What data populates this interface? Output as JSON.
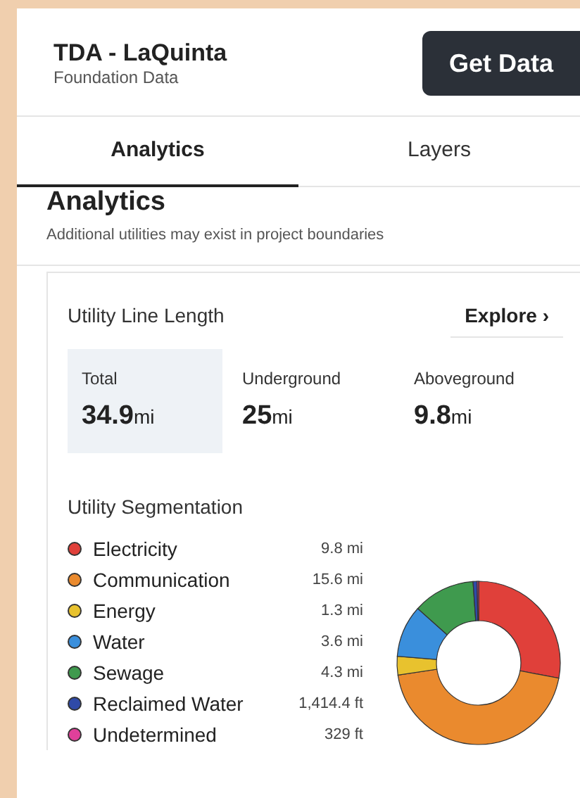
{
  "header": {
    "title": "TDA - LaQuinta",
    "subtitle": "Foundation Data",
    "button": "Get Data"
  },
  "tabs": [
    {
      "label": "Analytics",
      "selected": true
    },
    {
      "label": "Layers",
      "selected": false
    }
  ],
  "section": {
    "title": "Analytics",
    "note": "Additional utilities may exist in project boundaries"
  },
  "line_length": {
    "title": "Utility Line Length",
    "link": "Explore",
    "link_icon": "›",
    "stats": [
      {
        "label": "Total",
        "value": "34.9",
        "unit": "mi",
        "selected": true
      },
      {
        "label": "Underground",
        "value": "25",
        "unit": "mi",
        "selected": false
      },
      {
        "label": "Aboveground",
        "value": "9.8",
        "unit": "mi",
        "selected": false
      }
    ]
  },
  "segmentation": {
    "title": "Utility Segmentation",
    "items": [
      {
        "amount": "9.8 mi",
        "color": "#e0403a"
      },
      {
        "amount": "15.6 mi",
        "color": "#ea8a2e"
      },
      {
        "amount": "1.3 mi",
        "color": "#e8c22e"
      },
      {
        "amount": "3.6 mi",
        "color": "#3a8fdc"
      },
      {
        "amount": "4.3 mi",
        "color": "#3f9a4e"
      },
      {
        "amount": "1,414.4 ft",
        "color": "#2f4aa8"
      },
      {
        "amount": "329 ft",
        "color": "#e0409a"
      }
    ],
    "chart_data": {
      "type": "donut",
      "categories": [
        "Electricity",
        "Communication",
        "Energy",
        "Water",
        "Sewage",
        "Reclaimed Water",
        "Undetermined"
      ],
      "values": [
        28.0,
        44.6,
        3.7,
        10.3,
        12.3,
        0.8,
        0.3
      ]
    }
  }
}
